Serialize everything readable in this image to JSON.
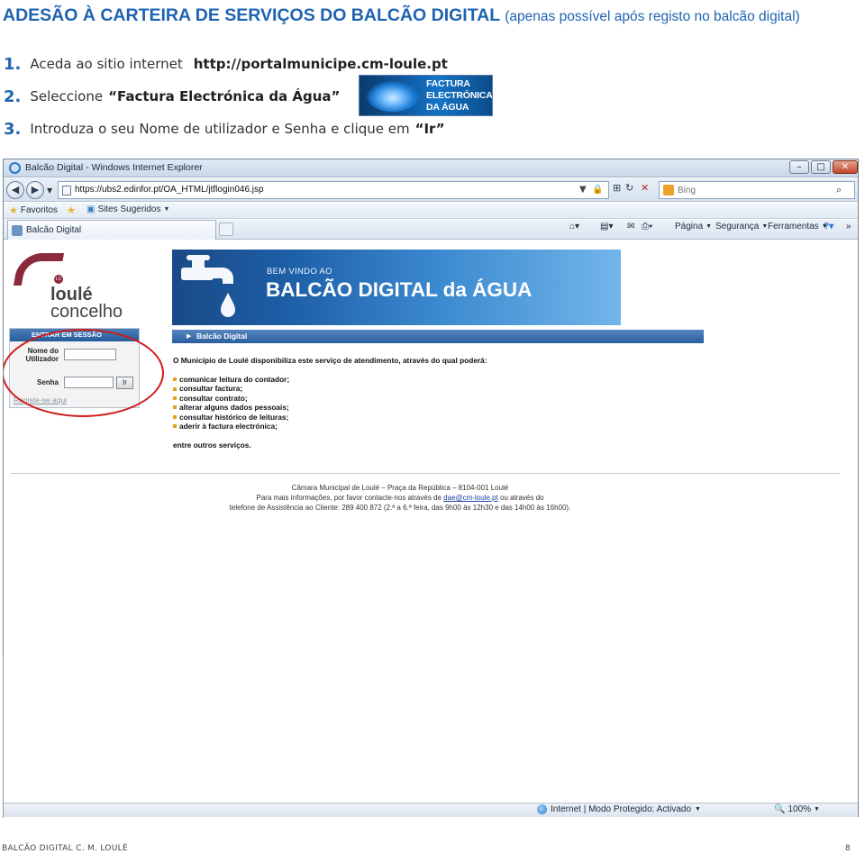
{
  "doc": {
    "title": "ADESÃO À CARTEIRA DE SERVIÇOS DO BALCÃO DIGITAL",
    "subtitle": "(apenas possível após registo no balcão digital)",
    "steps": [
      {
        "num": "1.",
        "text": "Aceda ao sitio internet",
        "bold": "http://portalmunicipe.cm-loule.pt"
      },
      {
        "num": "2.",
        "text": "Seleccione",
        "bold": "“Factura Electrónica da Água”"
      },
      {
        "num": "3.",
        "text": "Introduza o seu Nome de utilizador e Senha e clique em",
        "bold": "“Ir”"
      }
    ],
    "factura_logo": "FACTURA\nELECTRÓNICA\nDA ÁGUA",
    "footer_left": "BALCÃO DIGITAL C. M. LOULÉ",
    "footer_right": "8"
  },
  "browser": {
    "window_title": "Balcão Digital - Windows Internet Explorer",
    "url": "https://ubs2.edinfor.pt/OA_HTML/jtflogin046.jsp",
    "search_placeholder": "Bing",
    "favorites_label": "Favoritos",
    "suggested_sites_label": "Sites Sugeridos",
    "tab_label": "Balcão Digital",
    "cmd_page": "Página",
    "cmd_security": "Segurança",
    "cmd_tools": "Ferramentas",
    "status_zone": "Internet | Modo Protegido: Activado",
    "zoom": "100%"
  },
  "page": {
    "logo_name": "loulé",
    "logo_sub": "concelho",
    "logo_badge": "LC",
    "banner_welcome": "BEM VINDO AO",
    "banner_title": "BALCÃO DIGITAL da ÁGUA",
    "login": {
      "header": "ENTRAR EM SESSÃO",
      "user_label": "Nome do\nUtilizador",
      "password_label": "Senha",
      "go_button": "Ir",
      "register_link": "Registe-se aqui"
    },
    "section_title": "Balcão Digital",
    "intro": "O Município de Loulé disponibiliza este serviço de atendimento, através do qual poderá:",
    "services": [
      "comunicar leitura do contador;",
      "consultar factura;",
      "consultar contrato;",
      "alterar alguns dados pessoais;",
      "consultar histórico de leituras;",
      "aderir à factura electrónica;"
    ],
    "others": "entre outros serviços.",
    "contact": {
      "line1": "Câmara Municipal de Loulé – Praça da República – 8104-001 Loulé",
      "line2_pre": "Para mais informações, por favor contacte-nos através de ",
      "email": "dae@cm-loule.pt",
      "line2_post": " ou através do",
      "line3": "telefone de Assistência ao Cliente: 289 400 872 (2.ª a 6.ª feira, das 9h00 às 12h30 e das 14h00 às 16h00)."
    }
  },
  "colors": {
    "heading_blue": "#1f63b3",
    "loule_red": "#8b2a3d",
    "highlight_circle": "#d11a1a"
  }
}
